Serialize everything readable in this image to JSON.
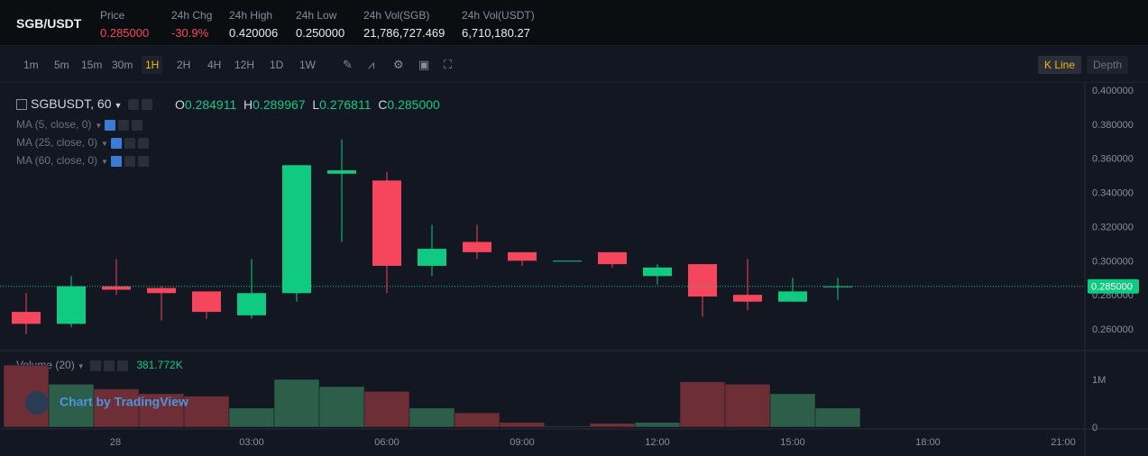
{
  "ticker": {
    "symbol": "SGB/USDT",
    "stats": [
      {
        "label": "Price",
        "value": "0.285000",
        "color": "#f6465d"
      },
      {
        "label": "24h Chg",
        "value": "-30.9%",
        "color": "#f6465d"
      },
      {
        "label": "24h High",
        "value": "0.420006",
        "color": "#eaecef"
      },
      {
        "label": "24h Low",
        "value": "0.250000",
        "color": "#eaecef"
      },
      {
        "label": "24h Vol(SGB)",
        "value": "21,786,727.469",
        "color": "#eaecef"
      },
      {
        "label": "24h Vol(USDT)",
        "value": "6,710,180.27",
        "color": "#eaecef"
      }
    ]
  },
  "toolbar": {
    "timeframes": [
      "1m",
      "5m",
      "15m",
      "30m",
      "1H",
      "2H",
      "4H",
      "12H",
      "1D",
      "1W"
    ],
    "active_timeframe": "1H",
    "tools": [
      "draw-icon",
      "indicator-icon",
      "settings-icon",
      "snapshot-icon",
      "fullscreen-icon"
    ],
    "modes": [
      "K Line",
      "Depth"
    ],
    "active_mode": "K Line"
  },
  "legend": {
    "symbol": "SGBUSDT, 60",
    "open_label": "O",
    "open": "0.284911",
    "high_label": "H",
    "high": "0.289967",
    "low_label": "L",
    "low": "0.276811",
    "close_label": "C",
    "close": "0.285000",
    "ma": [
      "MA (5, close, 0)",
      "MA (25, close, 0)",
      "MA (60, close, 0)"
    ],
    "volume_label": "Volume (20)",
    "volume_value": "381.772K"
  },
  "watermark": "Chart by TradingView",
  "colors": {
    "up": "#0ecb81",
    "down": "#f6465d",
    "accent": "#f0b90b",
    "background": "#131722"
  },
  "chart_data": {
    "type": "candlestick",
    "x_ticks": [
      "28",
      "03:00",
      "06:00",
      "09:00",
      "12:00",
      "15:00",
      "18:00",
      "21:00"
    ],
    "y_ticks": [
      "0.260000",
      "0.280000",
      "0.300000",
      "0.320000",
      "0.340000",
      "0.360000",
      "0.380000",
      "0.400000"
    ],
    "ylim": [
      0.25,
      0.405
    ],
    "current_price": "0.285000",
    "volume_ticks": [
      "0",
      "1M"
    ],
    "candles": [
      {
        "o": 0.27,
        "h": 0.281,
        "l": 0.257,
        "c": 0.263
      },
      {
        "o": 0.263,
        "h": 0.291,
        "l": 0.261,
        "c": 0.285
      },
      {
        "o": 0.285,
        "h": 0.301,
        "l": 0.28,
        "c": 0.283
      },
      {
        "o": 0.284,
        "h": 0.285,
        "l": 0.265,
        "c": 0.281
      },
      {
        "o": 0.282,
        "h": 0.282,
        "l": 0.266,
        "c": 0.27
      },
      {
        "o": 0.268,
        "h": 0.301,
        "l": 0.266,
        "c": 0.281
      },
      {
        "o": 0.281,
        "h": 0.356,
        "l": 0.276,
        "c": 0.356
      },
      {
        "o": 0.351,
        "h": 0.371,
        "l": 0.311,
        "c": 0.353
      },
      {
        "o": 0.347,
        "h": 0.352,
        "l": 0.281,
        "c": 0.297
      },
      {
        "o": 0.297,
        "h": 0.321,
        "l": 0.291,
        "c": 0.307
      },
      {
        "o": 0.311,
        "h": 0.321,
        "l": 0.301,
        "c": 0.305
      },
      {
        "o": 0.305,
        "h": 0.305,
        "l": 0.297,
        "c": 0.3
      },
      {
        "o": 0.3,
        "h": 0.3,
        "l": 0.3,
        "c": 0.3
      },
      {
        "o": 0.305,
        "h": 0.305,
        "l": 0.296,
        "c": 0.298
      },
      {
        "o": 0.291,
        "h": 0.298,
        "l": 0.286,
        "c": 0.296
      },
      {
        "o": 0.298,
        "h": 0.298,
        "l": 0.267,
        "c": 0.279
      },
      {
        "o": 0.28,
        "h": 0.301,
        "l": 0.271,
        "c": 0.276
      },
      {
        "o": 0.276,
        "h": 0.29,
        "l": 0.276,
        "c": 0.282
      },
      {
        "o": 0.285,
        "h": 0.29,
        "l": 0.277,
        "c": 0.285
      }
    ],
    "volume": [
      1300000,
      900000,
      800000,
      700000,
      650000,
      400000,
      1000000,
      850000,
      750000,
      400000,
      300000,
      100000,
      20000,
      80000,
      100000,
      950000,
      900000,
      700000,
      400000
    ]
  }
}
